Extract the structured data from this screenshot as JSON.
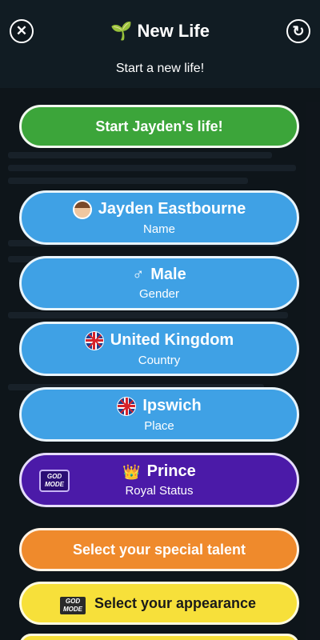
{
  "header": {
    "title": "New Life",
    "subtitle": "Start a new life!",
    "title_icon": "sprout-icon",
    "close_icon": "close-icon",
    "refresh_icon": "refresh-icon"
  },
  "start_button": {
    "label": "Start Jayden's life!"
  },
  "fields": {
    "name": {
      "value": "Jayden Eastbourne",
      "label": "Name",
      "icon": "avatar-icon"
    },
    "gender": {
      "value": "Male",
      "label": "Gender",
      "symbol": "♂"
    },
    "country": {
      "value": "United Kingdom",
      "label": "Country",
      "icon": "uk-flag-icon"
    },
    "place": {
      "value": "Ipswich",
      "label": "Place",
      "icon": "uk-flag-icon"
    },
    "royal": {
      "value": "Prince",
      "label": "Royal Status",
      "icon": "crown-icon",
      "badge_line1": "GOD",
      "badge_line2": "MODE"
    }
  },
  "talent_button": {
    "label": "Select your special talent"
  },
  "appearance_button": {
    "label": "Select your appearance",
    "badge_line1": "GOD",
    "badge_line2": "MODE"
  },
  "colors": {
    "green": "#3ca53a",
    "blue": "#3fa1e5",
    "purple": "#4b1aa8",
    "orange": "#ef8a2c",
    "yellow": "#f7e03a"
  }
}
